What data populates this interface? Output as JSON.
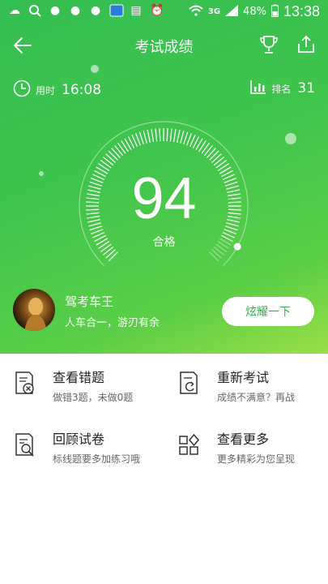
{
  "statusbar": {
    "network": "3G",
    "battery": "48%",
    "time": "13:38"
  },
  "header": {
    "title": "考试成绩"
  },
  "stats": {
    "time_label": "用时",
    "time_value": "16:08",
    "rank_label": "排名",
    "rank_value": "31"
  },
  "result": {
    "score": "94",
    "verdict": "合格",
    "gauge_fraction": 0.94
  },
  "user": {
    "name": "驾考车王",
    "motto": "人车合一，游刃有余",
    "showoff_label": "炫耀一下"
  },
  "actions": [
    {
      "title": "查看错题",
      "subtitle": "做错3题，未做0题",
      "icon": "wrong-questions-icon"
    },
    {
      "title": "重新考试",
      "subtitle": "成绩不满意？再战",
      "icon": "retake-exam-icon"
    },
    {
      "title": "回顾试卷",
      "subtitle": "标线题要多加练习哦",
      "icon": "review-paper-icon"
    },
    {
      "title": "查看更多",
      "subtitle": "更多精彩为您呈现",
      "icon": "more-apps-icon"
    }
  ],
  "colors": {
    "accent": "#3cc24e",
    "button_text": "#35b34a"
  }
}
